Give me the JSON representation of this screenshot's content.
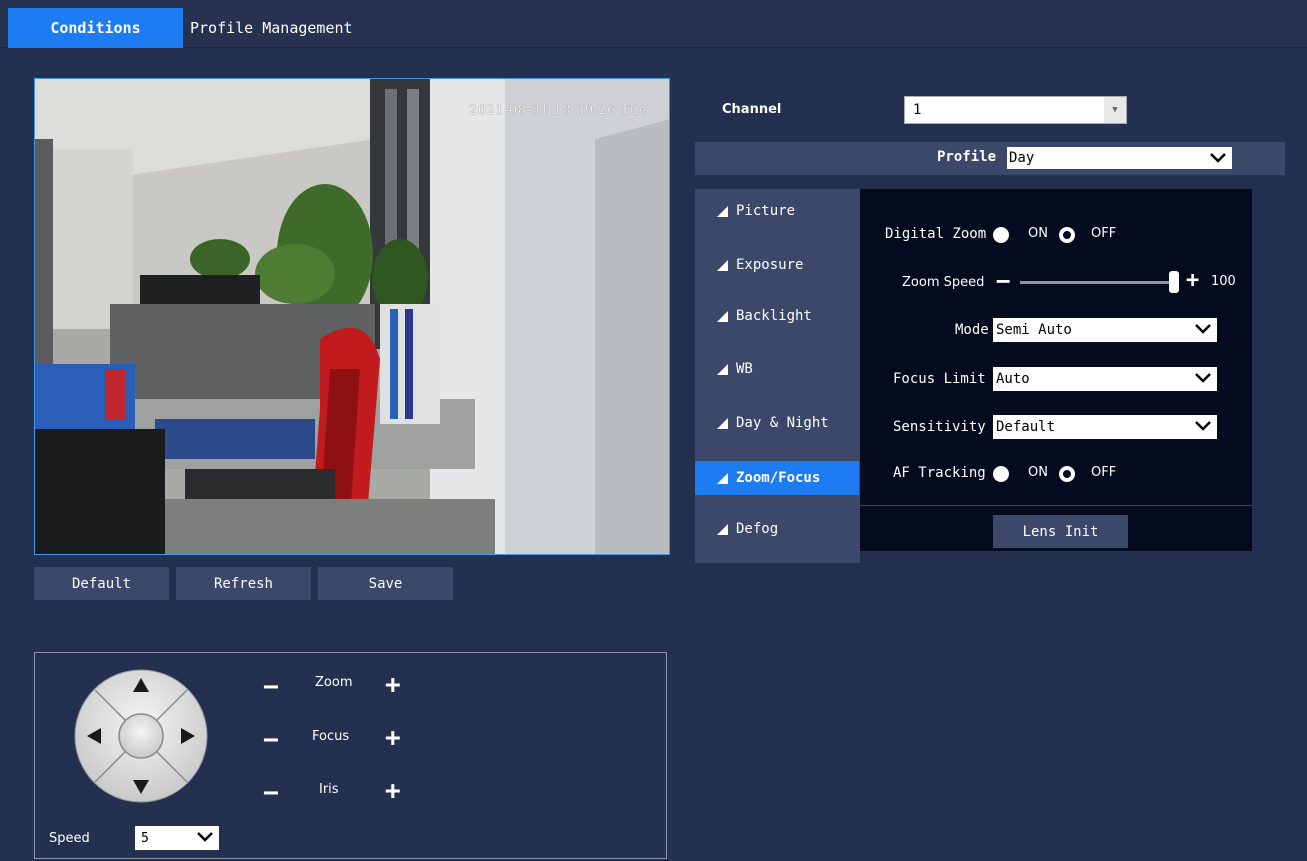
{
  "tabs": {
    "conditions": "Conditions",
    "profile_management": "Profile Management"
  },
  "preview": {
    "timestamp": "2021-08-31 18:39:26 Tue"
  },
  "actions": {
    "default": "Default",
    "refresh": "Refresh",
    "save": "Save"
  },
  "ptz": {
    "zoom": "Zoom",
    "focus": "Focus",
    "iris": "Iris",
    "minus": "−",
    "plus": "+",
    "speed_label": "Speed",
    "speed_value": "5"
  },
  "channel": {
    "label": "Channel",
    "value": "1"
  },
  "profile": {
    "label": "Profile",
    "value": "Day"
  },
  "menu": {
    "items": [
      "Picture",
      "Exposure",
      "Backlight",
      "WB",
      "Day & Night",
      "Zoom/Focus",
      "Defog"
    ],
    "active": "Zoom/Focus"
  },
  "settings": {
    "digital_zoom": {
      "label": "Digital Zoom",
      "on": "ON",
      "off": "OFF",
      "selected": "OFF"
    },
    "zoom_speed": {
      "label": "Zoom Speed",
      "value": "100",
      "level": 100
    },
    "mode": {
      "label": "Mode",
      "value": "Semi Auto"
    },
    "focus_limit": {
      "label": "Focus Limit",
      "value": "Auto"
    },
    "sensitivity": {
      "label": "Sensitivity",
      "value": "Default"
    },
    "af_tracking": {
      "label": "AF Tracking",
      "on": "ON",
      "off": "OFF",
      "selected": "OFF"
    },
    "lens_init": "Lens Init"
  },
  "colors": {
    "accent": "#1e7cf2",
    "background": "#24304f",
    "panel": "#3c4869",
    "settings_bg": "#050b1e"
  }
}
